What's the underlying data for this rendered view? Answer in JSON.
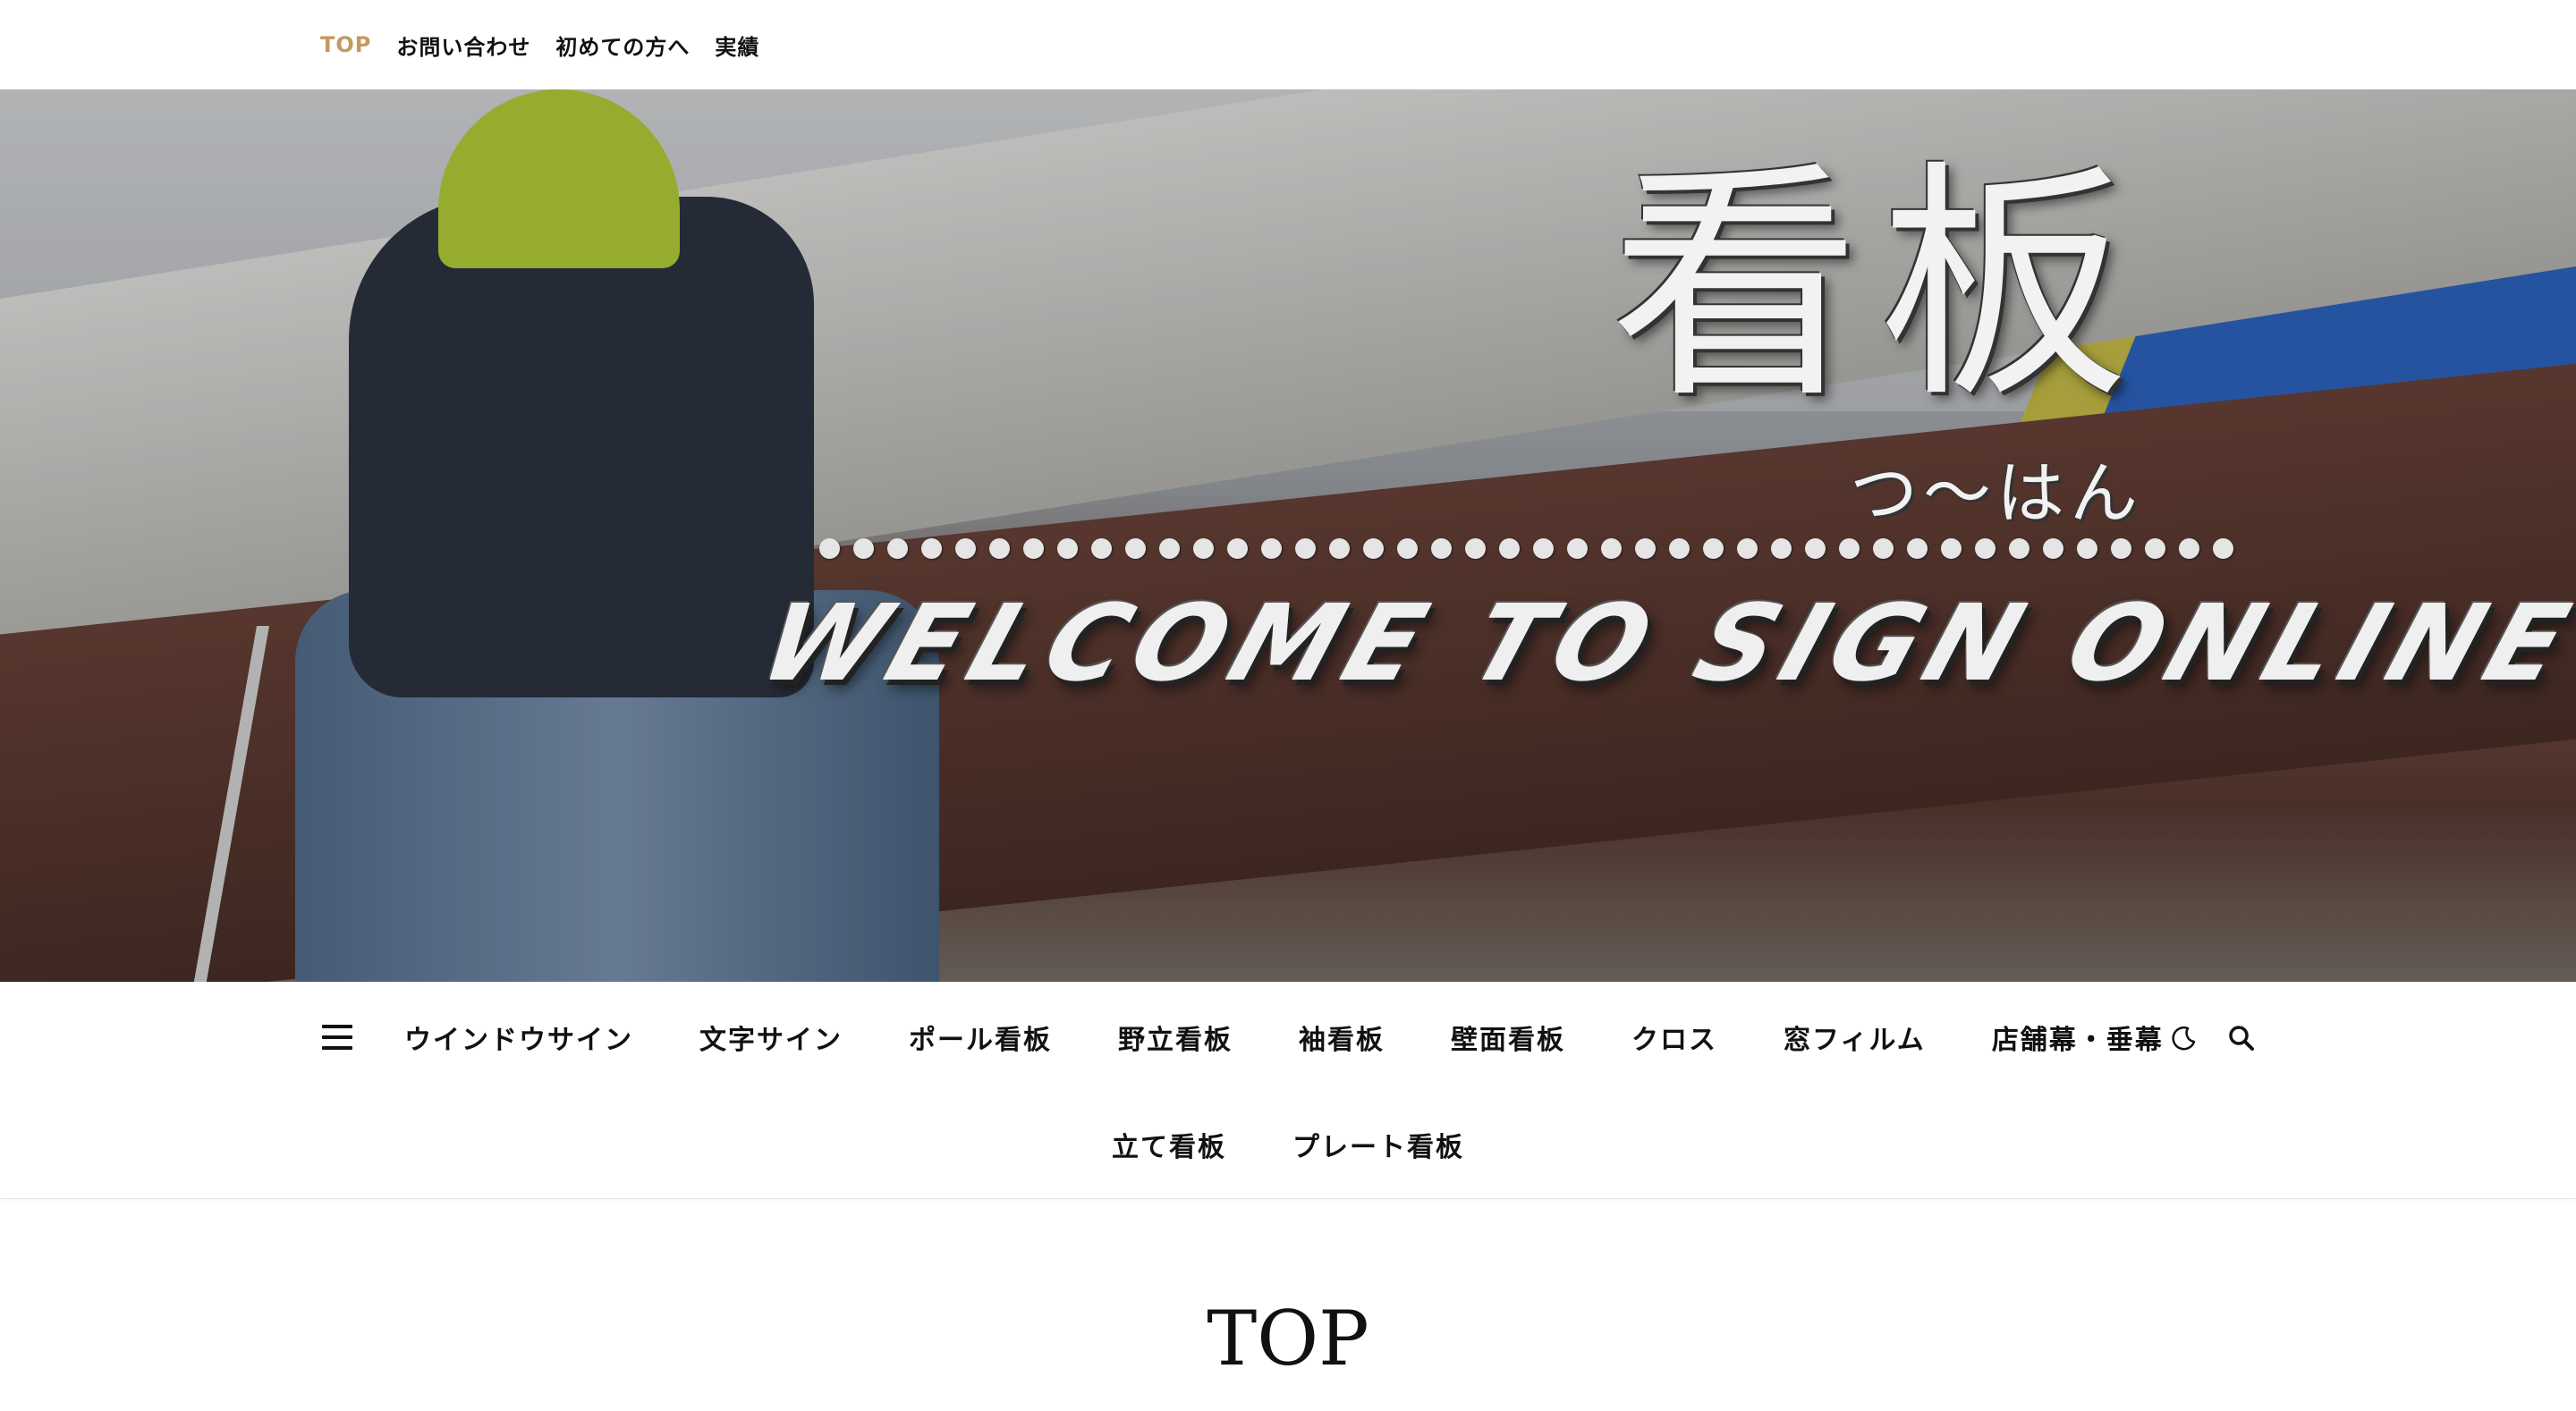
{
  "top_nav": {
    "items": [
      {
        "label": "TOP",
        "active": true
      },
      {
        "label": "お問い合わせ",
        "active": false
      },
      {
        "label": "初めての方へ",
        "active": false
      },
      {
        "label": "実績",
        "active": false
      }
    ],
    "active_color": "#c39a5e"
  },
  "hero": {
    "title": "看板",
    "subtitle": "つ～はん",
    "welcome": "WELCOME TO SIGN ONLINE SHOP"
  },
  "main_nav": {
    "row1": [
      "ウインドウサイン",
      "文字サイン",
      "ポール看板",
      "野立看板",
      "袖看板",
      "壁面看板",
      "クロス",
      "窓フィルム",
      "店舗幕・垂幕"
    ],
    "row2": [
      "立て看板",
      "プレート看板"
    ],
    "icons": [
      "menu-icon",
      "moon-icon",
      "search-icon"
    ]
  },
  "page": {
    "title": "TOP"
  }
}
